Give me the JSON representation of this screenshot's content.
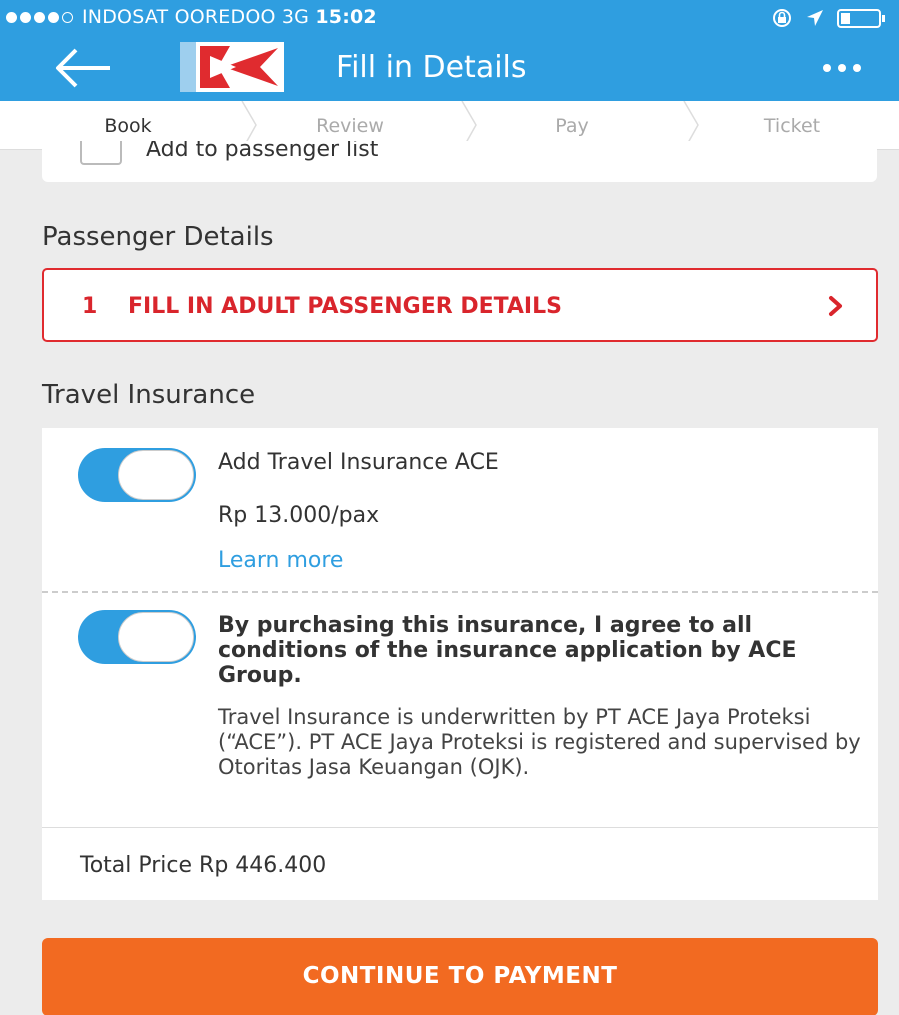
{
  "status_bar": {
    "carrier": "INDOSAT OOREDOO",
    "network": "3G",
    "time": "15:02"
  },
  "header": {
    "title": "Fill in Details"
  },
  "steps": [
    {
      "label": "Book",
      "active": true
    },
    {
      "label": "Review",
      "active": false
    },
    {
      "label": "Pay",
      "active": false
    },
    {
      "label": "Ticket",
      "active": false
    }
  ],
  "contact": {
    "add_to_list_label": "Add to passenger list"
  },
  "passenger": {
    "section_title": "Passenger Details",
    "count": "1",
    "button_label": "FILL IN ADULT PASSENGER DETAILS"
  },
  "insurance": {
    "section_title": "Travel Insurance",
    "name": "Add Travel Insurance ACE",
    "price": "Rp 13.000/pax",
    "learn_more": "Learn more",
    "agree_text": "By purchasing this insurance, I agree to all conditions of the insurance application by ACE Group.",
    "underwritten_text": "Travel Insurance is underwritten by PT ACE Jaya Proteksi (“ACE”). PT ACE Jaya Proteksi is registered and supervised by Otoritas Jasa Keuangan (OJK).",
    "add_enabled": true,
    "agree_enabled": true
  },
  "total": {
    "label": "Total Price Rp 446.400"
  },
  "continue_button": {
    "label": "CONTINUE TO PAYMENT"
  },
  "colors": {
    "primary": "#2f9ee0",
    "accent_red": "#d9252c",
    "cta_orange": "#f26a21"
  }
}
